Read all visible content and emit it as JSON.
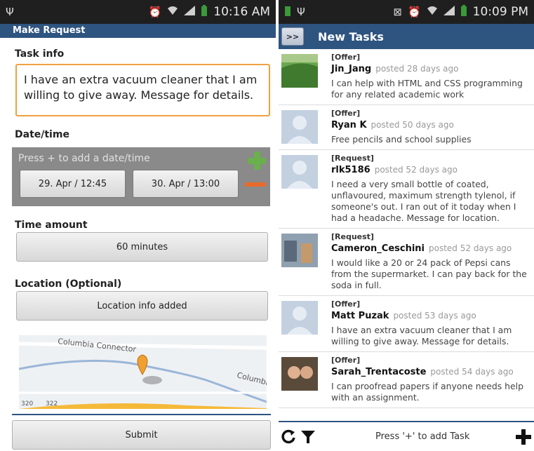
{
  "left": {
    "status": {
      "time": "10:16 AM"
    },
    "appbar": {
      "title": "Make Request"
    },
    "task_info": {
      "label": "Task info",
      "value": "I have an extra vacuum cleaner that I am willing to give away. Message for details."
    },
    "datetime": {
      "label": "Date/time",
      "hint": "Press + to add a date/time",
      "slots": [
        "29. Apr / 12:45",
        "30. Apr / 13:00"
      ]
    },
    "time_amount": {
      "label": "Time amount",
      "value": "60 minutes"
    },
    "location": {
      "label": "Location (Optional)",
      "button": "Location info added",
      "map_labels": [
        "Columbia Connector",
        "Columbia",
        "320",
        "322"
      ]
    },
    "submit_label": "Submit"
  },
  "right": {
    "status": {
      "time": "10:09 PM"
    },
    "appbar": {
      "menu_label": ">>",
      "title": "New Tasks"
    },
    "tasks": [
      {
        "type": "[Offer]",
        "user": "Jin_Jang",
        "posted": "posted 28 days ago",
        "body": "I can help with HTML and CSS programming for any related academic work"
      },
      {
        "type": "[Offer]",
        "user": "Ryan K",
        "posted": "posted 50 days ago",
        "body": "Free pencils and school supplies"
      },
      {
        "type": "[Request]",
        "user": "rlk5186",
        "posted": "posted 52 days ago",
        "body": "I need a very small bottle of coated, unflavoured, maximum strength tylenol, if someone's out. I ran out of it today when I had a headache. Message for location."
      },
      {
        "type": "[Request]",
        "user": "Cameron_Ceschini",
        "posted": "posted 52 days ago",
        "body": "I would like a 20 or 24 pack of Pepsi cans from the supermarket. I can pay back for the soda in full."
      },
      {
        "type": "[Offer]",
        "user": "Matt Puzak",
        "posted": "posted 53 days ago",
        "body": "I have an extra vacuum cleaner that I am willing to give away. Message for details."
      },
      {
        "type": "[Offer]",
        "user": "Sarah_Trentacoste",
        "posted": "posted 54 days ago",
        "body": "I can proofread papers if anyone needs help with an assignment."
      }
    ],
    "bottom_hint": "Press '+' to add Task"
  },
  "colors": {
    "accent": "#2e5480",
    "highlight": "#f0a040",
    "add": "#6ab04c",
    "remove": "#e86a2a"
  }
}
